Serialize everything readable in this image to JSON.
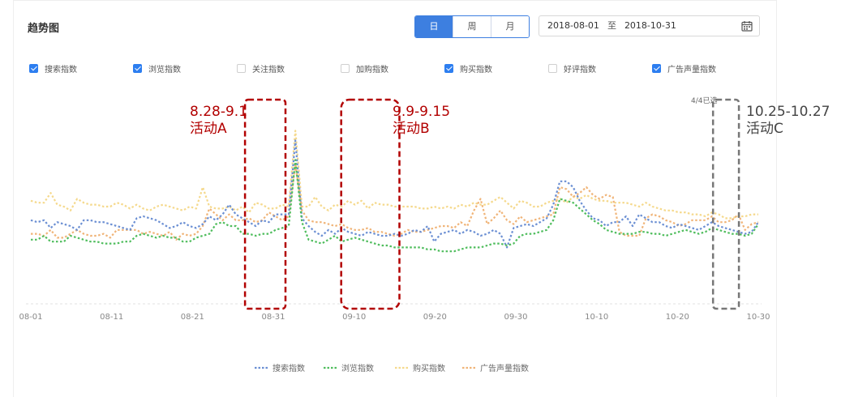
{
  "header": {
    "title": "趋势图",
    "period_tabs": [
      {
        "label": "日",
        "active": true
      },
      {
        "label": "周",
        "active": false
      },
      {
        "label": "月",
        "active": false
      }
    ],
    "date_range": {
      "start": "2018-08-01",
      "sep": "至",
      "end": "2018-10-31"
    }
  },
  "filters": [
    {
      "label": "搜索指数",
      "checked": true
    },
    {
      "label": "浏览指数",
      "checked": true
    },
    {
      "label": "关注指数",
      "checked": false
    },
    {
      "label": "加购指数",
      "checked": false
    },
    {
      "label": "购买指数",
      "checked": true
    },
    {
      "label": "好评指数",
      "checked": false
    },
    {
      "label": "广告声量指数",
      "checked": true
    }
  ],
  "chart_data": {
    "type": "line",
    "title": "",
    "x_ticks": [
      "08-01",
      "08-11",
      "08-21",
      "08-31",
      "09-10",
      "09-20",
      "09-30",
      "10-10",
      "10-20",
      "10-30"
    ],
    "x_start": "2018-08-01",
    "x_end": "2018-10-30",
    "ylim": [
      0,
      10
    ],
    "grid": false,
    "legend_position": "bottom",
    "series": [
      {
        "name": "搜索指数",
        "color": "#6b8fd3",
        "values": [
          4.3,
          4.2,
          4.3,
          3.9,
          4.2,
          4.1,
          4.0,
          3.8,
          4.3,
          4.3,
          4.2,
          4.2,
          4.1,
          4.0,
          3.9,
          3.8,
          4.4,
          4.5,
          4.4,
          4.3,
          4.1,
          3.9,
          4.0,
          4.2,
          4.0,
          3.9,
          4.1,
          4.5,
          4.3,
          4.6,
          5.1,
          4.6,
          4.4,
          4.2,
          4.0,
          4.3,
          4.2,
          4.6,
          4.6,
          4.6,
          8.4,
          4.4,
          4.0,
          3.7,
          3.5,
          3.8,
          3.6,
          3.9,
          3.7,
          3.6,
          3.5,
          3.7,
          3.6,
          3.5,
          3.5,
          3.6,
          3.5,
          3.6,
          3.8,
          3.7,
          4.0,
          3.2,
          3.6,
          3.7,
          3.8,
          3.6,
          3.8,
          3.7,
          3.5,
          3.6,
          3.8,
          3.6,
          2.9,
          3.9,
          4.0,
          4.1,
          4.0,
          4.2,
          4.4,
          5.1,
          6.3,
          6.3,
          6.0,
          5.3,
          4.8,
          4.4,
          4.3,
          4.0,
          4.2,
          4.2,
          4.5,
          4.0,
          4.6,
          4.4,
          4.2,
          4.2,
          4.0,
          3.9,
          4.1,
          4.0,
          3.9,
          3.8,
          4.0,
          4.2,
          4.0,
          3.9,
          3.8,
          3.7,
          3.6,
          3.7,
          4.2
        ]
      },
      {
        "name": "浏览指数",
        "color": "#4fbd5d",
        "values": [
          3.3,
          3.3,
          3.5,
          3.2,
          3.2,
          3.2,
          3.5,
          3.4,
          3.3,
          3.2,
          3.2,
          3.1,
          3.1,
          3.1,
          3.2,
          3.2,
          3.5,
          3.6,
          3.5,
          3.4,
          3.5,
          3.4,
          3.4,
          3.2,
          3.2,
          3.4,
          3.5,
          3.6,
          4.1,
          4.2,
          4.0,
          4.0,
          3.6,
          3.6,
          3.5,
          3.6,
          3.6,
          3.8,
          3.9,
          4.0,
          7.4,
          4.2,
          3.3,
          3.2,
          3.1,
          3.3,
          3.5,
          3.2,
          3.3,
          3.4,
          3.3,
          3.2,
          3.1,
          3.0,
          3.0,
          2.9,
          2.9,
          2.9,
          2.9,
          2.9,
          2.8,
          2.8,
          2.7,
          2.7,
          2.7,
          2.8,
          2.9,
          2.9,
          2.9,
          3.0,
          3.1,
          3.1,
          3.0,
          3.1,
          3.5,
          3.6,
          3.6,
          3.7,
          3.8,
          4.3,
          5.4,
          5.3,
          5.2,
          4.9,
          4.6,
          4.3,
          4.1,
          3.8,
          3.7,
          3.6,
          3.6,
          3.6,
          3.7,
          3.7,
          3.6,
          3.6,
          3.5,
          3.6,
          3.7,
          3.8,
          3.7,
          3.6,
          3.7,
          3.9,
          3.8,
          3.7,
          3.6,
          3.6,
          3.5,
          3.6,
          4.1
        ]
      },
      {
        "name": "购买指数",
        "color": "#f5d98c",
        "values": [
          5.3,
          5.2,
          5.2,
          5.7,
          5.1,
          5.0,
          4.8,
          5.4,
          5.2,
          5.1,
          5.1,
          5.0,
          5.0,
          5.2,
          5.1,
          4.9,
          5.1,
          4.9,
          4.8,
          5.0,
          5.1,
          5.0,
          4.9,
          4.8,
          5.0,
          4.9,
          6.0,
          5.0,
          4.9,
          4.9,
          5.0,
          4.8,
          5.0,
          4.7,
          5.2,
          5.1,
          4.9,
          4.9,
          5.1,
          5.0,
          8.9,
          5.0,
          5.0,
          5.5,
          5.0,
          4.8,
          5.1,
          5.0,
          5.3,
          5.1,
          5.3,
          4.9,
          5.2,
          5.1,
          5.1,
          5.0,
          5.0,
          5.0,
          5.0,
          4.9,
          4.9,
          5.0,
          4.9,
          5.0,
          4.9,
          5.1,
          5.0,
          5.2,
          5.1,
          5.1,
          5.3,
          5.5,
          5.2,
          4.9,
          5.3,
          5.2,
          5.0,
          5.0,
          5.2,
          5.3,
          5.4,
          5.2,
          5.5,
          5.4,
          5.6,
          5.4,
          5.3,
          5.3,
          5.2,
          5.2,
          5.2,
          5.1,
          5.0,
          5.2,
          5.0,
          4.9,
          4.8,
          4.8,
          4.7,
          4.7,
          4.6,
          4.6,
          4.5,
          4.7,
          4.6,
          4.4,
          4.4,
          4.5,
          4.5,
          4.6,
          4.6
        ]
      },
      {
        "name": "广告声量指数",
        "color": "#f0b478",
        "values": [
          3.6,
          3.6,
          3.5,
          3.8,
          3.4,
          3.4,
          3.6,
          3.8,
          3.6,
          3.5,
          3.5,
          3.6,
          3.4,
          3.8,
          3.8,
          3.8,
          3.8,
          3.6,
          3.7,
          3.6,
          3.5,
          3.7,
          3.3,
          3.6,
          3.5,
          3.6,
          4.0,
          4.9,
          4.6,
          4.3,
          4.6,
          4.3,
          4.3,
          4.4,
          4.2,
          4.3,
          4.7,
          4.5,
          4.3,
          4.5,
          7.2,
          4.8,
          4.3,
          4.2,
          4.2,
          4.1,
          4.0,
          4.1,
          3.9,
          3.8,
          3.8,
          3.9,
          3.7,
          3.7,
          3.6,
          3.5,
          3.6,
          3.8,
          3.7,
          3.7,
          3.8,
          3.9,
          4.0,
          4.0,
          3.9,
          4.2,
          4.0,
          4.8,
          5.4,
          4.1,
          4.4,
          4.8,
          4.3,
          4.1,
          4.5,
          4.2,
          4.3,
          4.4,
          4.5,
          4.6,
          6.0,
          5.9,
          5.5,
          5.7,
          6.0,
          5.6,
          5.4,
          5.6,
          5.5,
          3.7,
          3.5,
          3.5,
          3.5,
          4.4,
          4.6,
          4.5,
          4.3,
          4.2,
          4.0,
          4.1,
          4.3,
          4.3,
          4.3,
          4.5,
          4.2,
          4.2,
          4.3,
          4.6,
          3.8,
          4.1,
          4.2
        ]
      }
    ],
    "highlights": [
      {
        "label": "8.28-9.1",
        "name": "活动A",
        "from": "2018-08-28",
        "to": "2018-09-01",
        "color": "#b20000"
      },
      {
        "label": "9.9-9.15",
        "name": "活动B",
        "from": "2018-09-09",
        "to": "2018-09-15",
        "color": "#b20000"
      },
      {
        "label": "10.25-10.27",
        "name": "活动C",
        "from": "2018-10-25",
        "to": "2018-10-27",
        "color": "#777777"
      }
    ],
    "pagination": "4/4已选"
  }
}
